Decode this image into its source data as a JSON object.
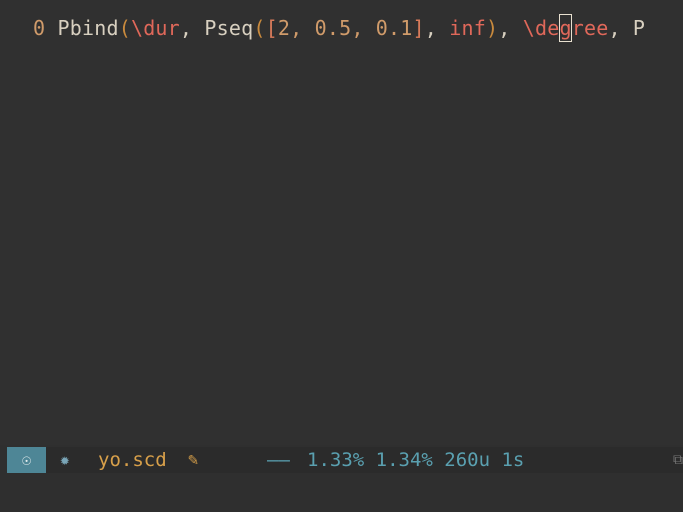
{
  "editor": {
    "line_number": "0",
    "tokens": {
      "t1": " Pbind",
      "t2": "(",
      "t3": "\\dur",
      "t4": ", Pseq",
      "t5": "(",
      "t6": "[",
      "t7": "2, 0.5, 0.1",
      "t8": "]",
      "t9": ", ",
      "t10": "inf",
      "t11": ")",
      "t12": ", ",
      "t13a": "\\de",
      "t13cursor": "g",
      "t13b": "ree",
      "t14": ", P"
    }
  },
  "modeline": {
    "state_icon": "☉",
    "gear_icon": "✹",
    "filename": "yo.scd",
    "edit_icon": "✎",
    "separator": "——",
    "stats": "1.33% 1.34% 260u 1s",
    "window_icon": "⧉"
  },
  "colors": {
    "background": "#303030",
    "state_badge": "#4e8696",
    "filename": "#d8a04a",
    "stats": "#5aa0b0"
  }
}
